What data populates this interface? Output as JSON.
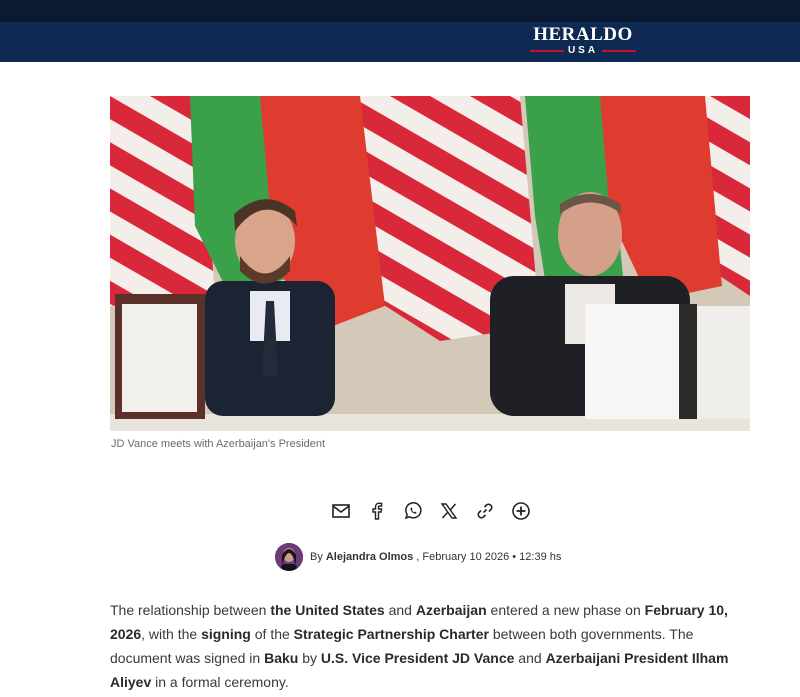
{
  "header": {
    "logo_main": "HERALDO",
    "logo_sub": "USA"
  },
  "photo": {
    "caption": "JD Vance meets with Azerbaijan's President"
  },
  "share": {
    "icons": [
      "mail-icon",
      "facebook-icon",
      "whatsapp-icon",
      "x-icon",
      "link-icon",
      "plus-icon"
    ]
  },
  "byline": {
    "by": "By",
    "author": "Alejandra Olmos",
    "date": ", February 10 2026 • 12:39 hs"
  },
  "article": {
    "p1_a": "The relationship between ",
    "p1_b": "the United States",
    "p1_c": " and ",
    "p1_d": "Azerbaijan",
    "p1_e": " entered a new phase on ",
    "p1_f": "February 10, 2026",
    "p1_g": ", with the ",
    "p1_h": "signing",
    "p1_i": " of the ",
    "p1_j": "Strategic Partnership Charter",
    "p1_k": " between both governments. The document was signed in ",
    "p1_l": "Baku",
    "p1_m": " by ",
    "p1_n": "U.S. Vice President JD Vance",
    "p1_o": " and ",
    "p1_p": "Azerbaijani President Ilham Aliyev",
    "p1_q": " in a formal ceremony."
  },
  "colors": {
    "header_bg": "#0e2a52",
    "topstrip_bg": "#0b1a33",
    "accent_red": "#c8102e"
  }
}
